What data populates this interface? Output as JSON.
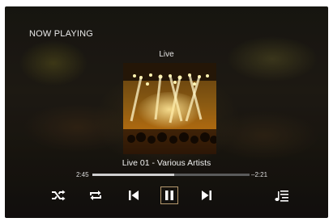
{
  "header": {
    "title": "NOW PLAYING"
  },
  "album": {
    "label": "Live"
  },
  "track": {
    "title": "Live 01 - Various Artists"
  },
  "progress": {
    "elapsed": "2:45",
    "remaining": "–2:21",
    "fraction": 0.52
  },
  "controls": {
    "shuffle": "shuffle-icon",
    "repeat": "repeat-icon",
    "previous": "skip-previous-icon",
    "play_pause": "pause-icon",
    "next": "skip-next-icon",
    "queue": "queue-music-icon"
  },
  "colors": {
    "accent_border": "#b79a6e",
    "progress_track": "#5b5b5b",
    "progress_fill": "#cfcfcf",
    "text": "#e8e8e8"
  }
}
